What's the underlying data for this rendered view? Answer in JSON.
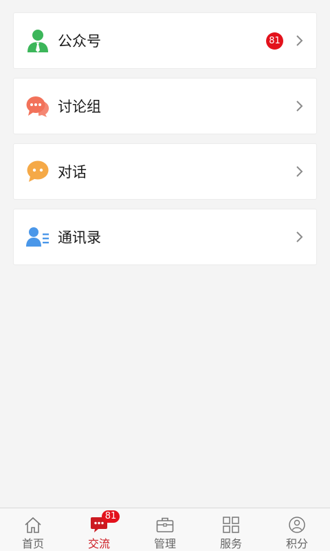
{
  "list": {
    "items": [
      {
        "label": "公众号",
        "icon": "official-account-icon",
        "badge": "81"
      },
      {
        "label": "讨论组",
        "icon": "discussion-group-icon"
      },
      {
        "label": "对话",
        "icon": "conversation-icon"
      },
      {
        "label": "通讯录",
        "icon": "contacts-icon"
      }
    ]
  },
  "tabbar": {
    "tabs": [
      {
        "label": "首页",
        "icon": "home-icon"
      },
      {
        "label": "交流",
        "icon": "chat-icon",
        "badge": "81",
        "active": true
      },
      {
        "label": "管理",
        "icon": "briefcase-icon"
      },
      {
        "label": "服务",
        "icon": "grid-icon"
      },
      {
        "label": "积分",
        "icon": "user-circle-icon"
      }
    ]
  },
  "colors": {
    "background": "#f4f4f4",
    "accent_red": "#cc1a21",
    "badge_red": "#e3121c",
    "green_icon": "#3cb65a",
    "coral_icon": "#f2725a",
    "orange_icon": "#f5a947",
    "blue_icon": "#4a97e9"
  }
}
